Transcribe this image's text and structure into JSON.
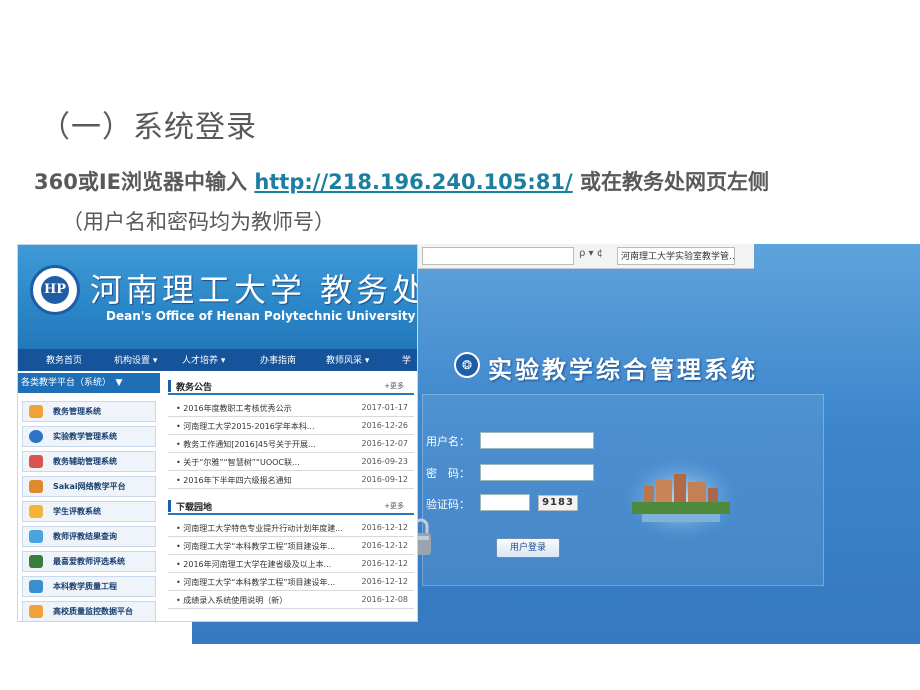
{
  "slide": {
    "title": "（一）系统登录",
    "line1_prefix": "360或IE浏览器中输入 ",
    "line1_link": "http://218.196.240.105:81/",
    "line1_suffix": " 或在教务处网页左侧",
    "line2": "（用户名和密码均为教师号）"
  },
  "dean": {
    "logo_text": "HP",
    "cn_title": "河南理工大学 教务处",
    "en_title": "Dean's Office of Henan Polytechnic University",
    "nav": [
      "教务首页",
      "机构设置 ▾",
      "人才培养 ▾",
      "办事指南",
      "教师风采 ▾",
      "学"
    ],
    "sidebar_header": "各类教学平台（系统）　▼",
    "sidebar_items": [
      "教务管理系统",
      "实验教学管理系统",
      "教务辅助管理系统",
      "Sakai网络教学平台",
      "学生评教系统",
      "教师评教结果查询",
      "最喜爱教师评选系统",
      "本科教学质量工程",
      "高校质量监控数据平台"
    ],
    "announcements": {
      "title": "教务公告",
      "more": "+更多",
      "items": [
        {
          "text": "2016年度教职工考核优秀公示",
          "date": "2017-01-17"
        },
        {
          "text": "河南理工大学2015-2016学年本科...",
          "date": "2016-12-26"
        },
        {
          "text": "教务工作通知[2016]45号关于开展...",
          "date": "2016-12-07"
        },
        {
          "text": "关于“尔雅”“智慧树”“UOOC联...",
          "date": "2016-09-23"
        },
        {
          "text": "2016年下半年四六级报名通知",
          "date": "2016-09-12"
        }
      ]
    },
    "downloads": {
      "title": "下载园地",
      "more": "+更多",
      "items": [
        {
          "text": "河南理工大学特色专业提升行动计划年度建...",
          "date": "2016-12-12"
        },
        {
          "text": "河南理工大学“本科教学工程”项目建设年...",
          "date": "2016-12-12"
        },
        {
          "text": "2016年河南理工大学在建省级及以上本...",
          "date": "2016-12-12"
        },
        {
          "text": "河南理工大学“本科教学工程”项目建设年...",
          "date": "2016-12-12"
        },
        {
          "text": "成绩录入系统使用说明（新）",
          "date": "2016-12-08"
        }
      ]
    }
  },
  "login": {
    "address_icons": "ρ ▾ ¢",
    "tab_label": "河南理工大学实验室教学管... ×",
    "system_name": "实验教学综合管理系统",
    "username_label": "用户名：",
    "password_label": "密　码：",
    "captcha_label": "验证码：",
    "captcha_image_text": "9183",
    "login_button": "用户登录"
  }
}
